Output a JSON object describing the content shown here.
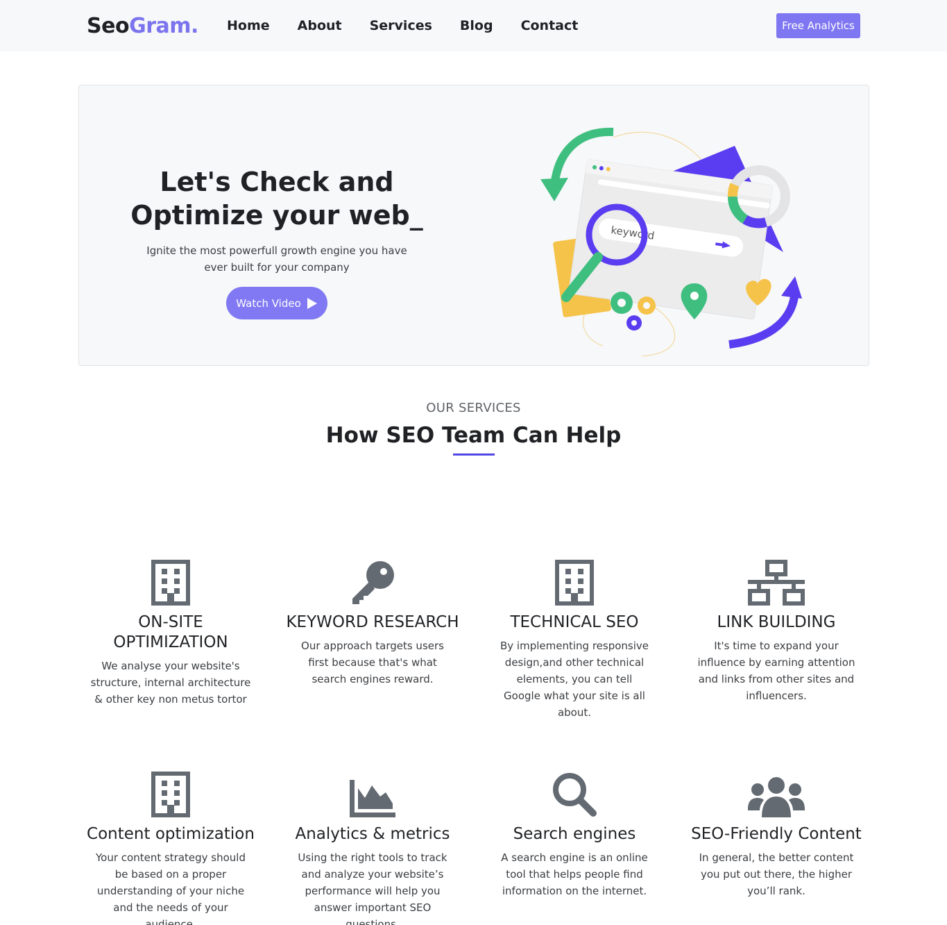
{
  "brand": {
    "logo_part1": "Seo",
    "logo_part2": "Gram.",
    "accent": "#7c74ee",
    "primary": "#4f46e5"
  },
  "nav": {
    "links": [
      "Home",
      "About",
      "Services",
      "Blog",
      "Contact"
    ],
    "cta_label": "Free Analytics"
  },
  "hero": {
    "title": "Let's Check and Optimize your web_",
    "subtitle": "Ignite the most powerfull growth engine you have ever built for your company",
    "button_label": "Watch Video",
    "button_icon": "play-icon",
    "illustration_text": "keyword"
  },
  "services": {
    "kicker": "OUR SERVICES",
    "title": "How SEO Team Can Help",
    "items": [
      {
        "icon": "building-icon",
        "title": "ON-SITE OPTIMIZATION",
        "desc": "We analyse your website's structure, internal architecture & other key non metus tortor"
      },
      {
        "icon": "key-icon",
        "title": "KEYWORD RESEARCH",
        "desc": "Our approach targets users first because that's what search engines reward."
      },
      {
        "icon": "building-icon",
        "title": "TECHNICAL SEO",
        "desc": "By implementing responsive design,and other technical elements, you can tell Google what your site is all about."
      },
      {
        "icon": "network-icon",
        "title": "LINK BUILDING",
        "desc": "It's time to expand your influence by earning attention and links from other sites and influencers."
      },
      {
        "icon": "building-icon",
        "title": "Content optimization",
        "desc": "Your content strategy should be based on a proper understanding of your niche and the needs of your audience."
      },
      {
        "icon": "area-chart-icon",
        "title": "Analytics & metrics",
        "desc": "Using the right tools to track and analyze your website’s performance will help you answer important SEO questions,"
      },
      {
        "icon": "search-icon",
        "title": "Search engines",
        "desc": "A search engine is an online tool that helps people find information on the internet."
      },
      {
        "icon": "users-icon",
        "title": "SEO-Friendly Content",
        "desc": "In general, the better content you put out there, the higher you’ll rank."
      }
    ]
  }
}
